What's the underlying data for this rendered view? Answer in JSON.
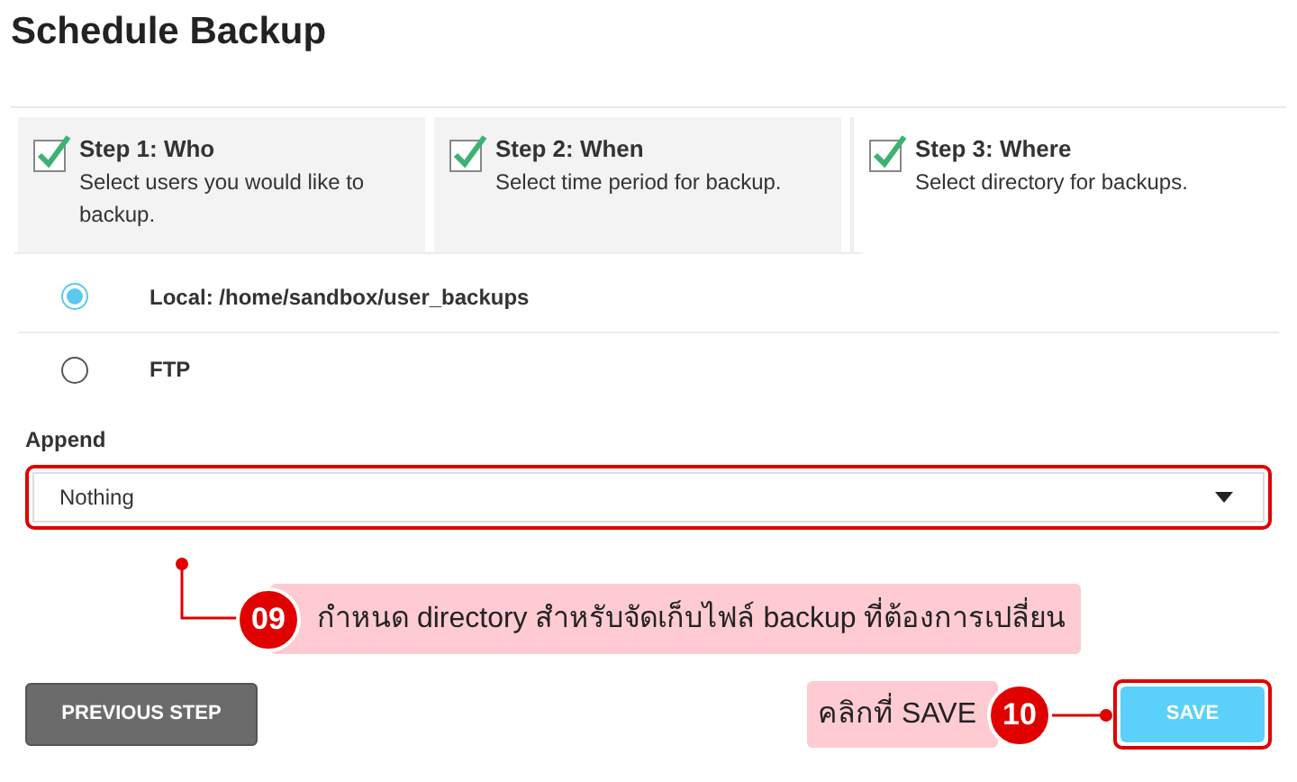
{
  "title": "Schedule Backup",
  "steps": [
    {
      "label": "Step 1: Who",
      "description": "Select users you would like to backup.",
      "checked": true,
      "selected": false
    },
    {
      "label": "Step 2: When",
      "description": "Select time period for backup.",
      "checked": true,
      "selected": false
    },
    {
      "label": "Step 3: Where",
      "description": "Select directory for backups.",
      "checked": true,
      "selected": true
    }
  ],
  "destinations": [
    {
      "label": "Local: /home/sandbox/user_backups",
      "selected": true
    },
    {
      "label": "FTP",
      "selected": false
    }
  ],
  "append": {
    "label": "Append",
    "value": "Nothing"
  },
  "buttons": {
    "previous": "PREVIOUS STEP",
    "save": "SAVE"
  },
  "annotations": [
    {
      "number": "09",
      "text": "กำหนด directory สำหรับจัดเก็บไฟล์ backup ที่ต้องการเปลี่ยน"
    },
    {
      "number": "10",
      "text": "คลิกที่ SAVE"
    }
  ]
}
